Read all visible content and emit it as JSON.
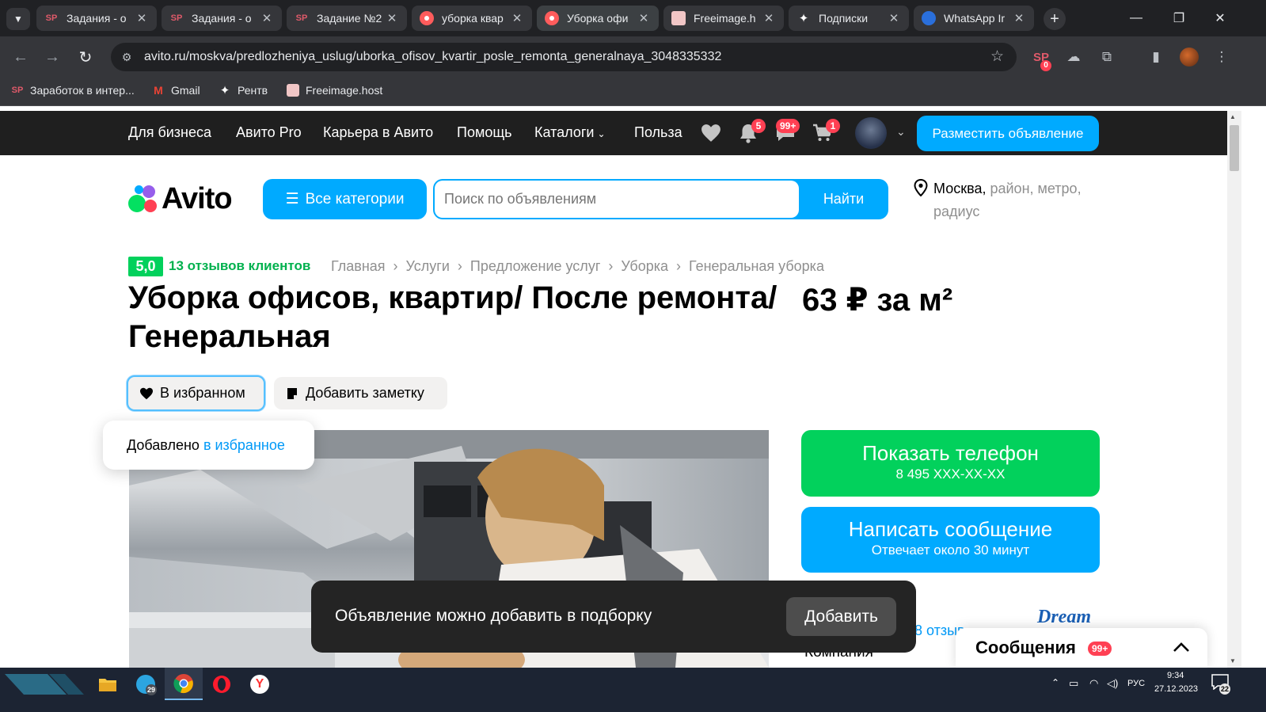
{
  "browser": {
    "tabs": [
      {
        "title": "Задания - о",
        "icon": "sp-icon"
      },
      {
        "title": "Задания - о",
        "icon": "sp-icon"
      },
      {
        "title": "Задание №2",
        "icon": "sp-icon"
      },
      {
        "title": "уборка квар",
        "icon": "record-icon"
      },
      {
        "title": "Уборка офи",
        "icon": "record-icon"
      },
      {
        "title": "Freeimage.h",
        "icon": "freeimage-icon"
      },
      {
        "title": "Подписки",
        "icon": "sparkle-icon"
      },
      {
        "title": "WhatsApp Ir",
        "icon": "whatsapp-icon"
      }
    ],
    "url": "avito.ru/moskva/predlozheniya_uslug/uborka_ofisov_kvartir_posle_remonta_generalnaya_3048335332",
    "extension_badge": "0",
    "bookmarks": [
      {
        "label": "Заработок в интер...",
        "icon": "sp-icon"
      },
      {
        "label": "Gmail",
        "icon": "gmail-icon"
      },
      {
        "label": "Рентв",
        "icon": "sparkle-icon"
      },
      {
        "label": "Freeimage.host",
        "icon": "freeimage-icon"
      }
    ]
  },
  "topbar": {
    "links": [
      "Для бизнеса",
      "Авито Pro",
      "Карьера в Авито",
      "Помощь",
      "Каталоги",
      "Польза"
    ],
    "badges": {
      "notifications": "5",
      "messages": "99+",
      "cart": "1"
    },
    "post_button": "Разместить объявление"
  },
  "header": {
    "logo_text": "Avito",
    "categories_button": "Все категории",
    "search": {
      "placeholder": "Поиск по объявлениям",
      "button": "Найти"
    },
    "location": {
      "city": "Москва,",
      "rest_line1": "район, метро,",
      "rest_line2": "радиус"
    }
  },
  "listing": {
    "rating": "5,0",
    "reviews": "13 отзывов клиентов",
    "breadcrumbs": [
      "Главная",
      "Услуги",
      "Предложение услуг",
      "Уборка",
      "Генеральная уборка"
    ],
    "title": "Уборка офисов, квартир/ После ремонта/ Генеральная",
    "price": "63 ₽ за м²",
    "favorite_button": "В избранном",
    "note_button": "Добавить заметку",
    "favorite_toast": {
      "text": "Добавлено",
      "link": "в избранное"
    }
  },
  "contact": {
    "phone_title": "Показать телефон",
    "phone_number": "8 495 XXX-XX-XX",
    "message_title": "Написать сообщение",
    "message_sub": "Отвечает около 30 минут",
    "seller_reviews": "8 отзыв",
    "seller_type": "Компания",
    "seller_logo": "Dream"
  },
  "snackbar": {
    "text": "Объявление можно добавить в подборку",
    "button": "Добавить"
  },
  "messenger": {
    "label": "Сообщения",
    "badge": "99+"
  },
  "taskbar": {
    "telegram_badge": "29",
    "language": "РУС",
    "time": "9:34",
    "date": "27.12.2023",
    "notifications": "22"
  },
  "colors": {
    "avito_blue": "#00aaff",
    "avito_green": "#02d15c",
    "badge_red": "#ff4053",
    "chrome_dark": "#202124"
  }
}
